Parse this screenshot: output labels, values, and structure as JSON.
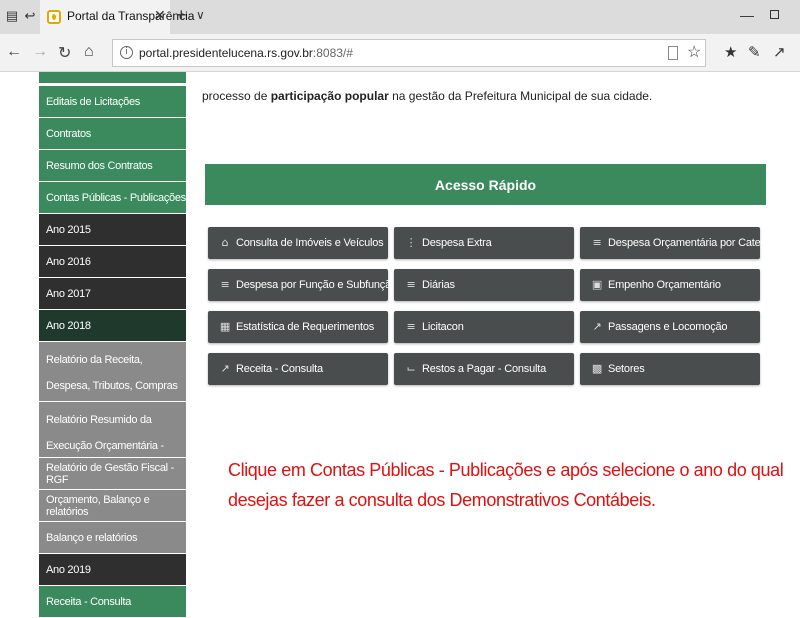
{
  "browser": {
    "tab_title": "Portal da Transparência",
    "url_host": "portal.presidentelucena.rs.gov.br",
    "url_rest": ":8083/#"
  },
  "sidebar": {
    "items": [
      {
        "label": "Editais de Licitações",
        "style": "green"
      },
      {
        "label": "Contratos",
        "style": "green"
      },
      {
        "label": "Resumo dos Contratos",
        "style": "green"
      },
      {
        "label": "Contas Públicas - Publicações",
        "style": "green"
      },
      {
        "label": "Ano 2015",
        "style": "dark"
      },
      {
        "label": "Ano 2016",
        "style": "dark"
      },
      {
        "label": "Ano 2017",
        "style": "dark"
      },
      {
        "label": "Ano 2018",
        "style": "darkgreen"
      },
      {
        "label": "Relatório da Receita, Despesa, Tributos, Compras",
        "style": "gray"
      },
      {
        "label": "Relatório Resumido da Execução Orçamentária - RREO",
        "style": "gray"
      },
      {
        "label": "Relatório de Gestão Fiscal - RGF",
        "style": "gray"
      },
      {
        "label": "Orçamento, Balanço e relatórios",
        "style": "gray"
      },
      {
        "label": "Balanço e relatórios",
        "style": "gray"
      },
      {
        "label": "Ano 2019",
        "style": "dark"
      },
      {
        "label": "Receita - Consulta",
        "style": "green"
      }
    ]
  },
  "main": {
    "intro_before": "processo de ",
    "intro_bold": "participação popular",
    "intro_after": " na gestão da Prefeitura Municipal de sua cidade.",
    "quick_access_title": "Acesso Rápido",
    "buttons": [
      {
        "label": "Consulta de Imóveis e Veículos",
        "icon": "home-icon"
      },
      {
        "label": "Despesa Extra",
        "icon": "grid-icon"
      },
      {
        "label": "Despesa Orçamentária por Categoria",
        "icon": "list-icon"
      },
      {
        "label": "Despesa por Função e Subfunção",
        "icon": "list-icon"
      },
      {
        "label": "Diárias",
        "icon": "list-icon"
      },
      {
        "label": "Empenho Orçamentário",
        "icon": "document-icon"
      },
      {
        "label": "Estatística de Requerimentos",
        "icon": "bar-chart-icon"
      },
      {
        "label": "Licitacon",
        "icon": "list-icon"
      },
      {
        "label": "Passagens e Locomoção",
        "icon": "trend-icon"
      },
      {
        "label": "Receita - Consulta",
        "icon": "trend-icon"
      },
      {
        "label": "Restos a Pagar - Consulta",
        "icon": "crop-icon"
      },
      {
        "label": "Setores",
        "icon": "table-icon"
      }
    ],
    "note": "Clique em Contas Públicas - Publicações e após selecione o ano do qual desejas fazer a consulta dos Demonstrativos Contábeis."
  },
  "colors": {
    "green": "#3a8a5e",
    "dark": "#2f2f2f",
    "darkgreen": "#1f3a2d",
    "gray": "#8a8a8a",
    "button": "#4a4d4d",
    "note": "#e01010"
  }
}
